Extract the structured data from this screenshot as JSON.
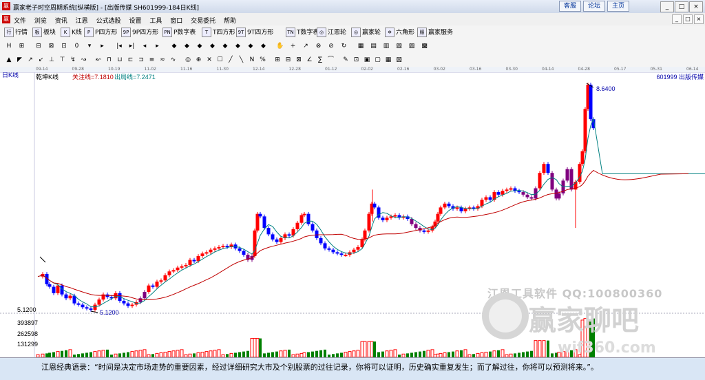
{
  "window": {
    "title": "赢家老子时空周期系统[纵横版] - [出版传媒  SH601999-184日K线]",
    "links": [
      "客服",
      "论坛",
      "主页"
    ],
    "buttons": [
      "_",
      "□",
      "×"
    ]
  },
  "menu": {
    "logo": "赢",
    "items": [
      "文件",
      "浏览",
      "资讯",
      "江恩",
      "公式选股",
      "设置",
      "工具",
      "窗口",
      "交易委托",
      "帮助"
    ],
    "mdi": [
      "_",
      "□",
      "×"
    ]
  },
  "toolbar1": [
    {
      "icon": "行",
      "label": "行情"
    },
    {
      "icon": "板",
      "label": "板块"
    },
    {
      "icon": "K",
      "label": "K线"
    },
    {
      "icon": "P",
      "label": "P四方形"
    },
    {
      "icon": "9P",
      "label": "9P四方形"
    },
    {
      "icon": "PN",
      "label": "P数字表"
    },
    {
      "icon": "T",
      "label": "T四方形"
    },
    {
      "icon": "9T",
      "label": "9T四方形"
    },
    {
      "icon": "TN",
      "label": "T数字表"
    },
    {
      "icon": "◎",
      "label": "江恩轮"
    },
    {
      "icon": "◎",
      "label": "赢家轮"
    },
    {
      "icon": "✡",
      "label": "六角形"
    },
    {
      "icon": "服",
      "label": "赢家服务"
    }
  ],
  "toolbar2_icons": [
    "H",
    "⊞",
    "⊟",
    "⊠",
    "⊡",
    "0",
    "▾",
    "▸",
    "|◂",
    "▸|",
    "◂",
    "▸",
    "◆",
    "◆",
    "◆",
    "◆",
    "◆",
    "◆",
    "◆",
    "◆",
    "✋",
    "+",
    "↗",
    "⊗",
    "⊘",
    "↻",
    "▦",
    "▤",
    "▥",
    "▧",
    "▨",
    "▩"
  ],
  "toolbar3_icons": [
    "▲",
    "◤",
    "↗",
    "↙",
    "⊥",
    "⊤",
    "↯",
    "↝",
    "↜",
    "⊓",
    "⊔",
    "⊏",
    "⊐",
    "≡",
    "≈",
    "∿",
    "◎",
    "⊕",
    "✕",
    "☐",
    "╱",
    "╲",
    "N",
    "%",
    "⊞",
    "⊟",
    "⊠",
    "∠",
    "∑",
    "⌒",
    "✎",
    "⊡",
    "▣",
    "▢",
    "▦",
    "▧"
  ],
  "dates": [
    "09-14",
    "09-28",
    "10-19",
    "11-02",
    "11-16",
    "11-30",
    "12-14",
    "12-28",
    "01-12",
    "02-02",
    "02-16",
    "03-02",
    "03-16",
    "03-30",
    "04-14",
    "04-28",
    "05-17",
    "05-31",
    "06-14"
  ],
  "chart": {
    "period_label": "日K线",
    "indicator": "乾坤K线",
    "attention_line": "关注线=7.1810",
    "exit_line": "出局线=7.2471",
    "symbol": "601999 出版传媒",
    "high_label": "8.6400",
    "low_label": "5.1200",
    "price_axis": "5.1200",
    "volume_ticks": [
      "393897",
      "262598",
      "131299"
    ]
  },
  "chart_data": {
    "type": "candlestick",
    "title": "",
    "price_ylim": [
      5.12,
      8.64
    ],
    "high": 8.64,
    "low": 5.12,
    "attention_line": 7.181,
    "exit_line": 7.2471,
    "volume_ylim": [
      0,
      393897
    ],
    "volume_ticks": [
      131299,
      262598,
      393897
    ],
    "series": [
      {
        "name": "关注线",
        "color": "#c00000"
      },
      {
        "name": "出局线",
        "color": "#008080"
      }
    ]
  },
  "watermark": {
    "line1": "江恩工具软件  QQ:100800360",
    "line2": "赢家聊吧",
    "line3": "wif360.com"
  },
  "status_quote": "江恩经典语录：“时间是决定市场走势的重要因素，经过详细研究大市及个别股票的过往记录，你将可以证明，历史确实重复发生；而了解过往，你将可以预测将来。”。",
  "colors": {
    "up": "#ff0000",
    "down": "#0000ff",
    "purple": "#800080",
    "vol_up": "#008000"
  }
}
